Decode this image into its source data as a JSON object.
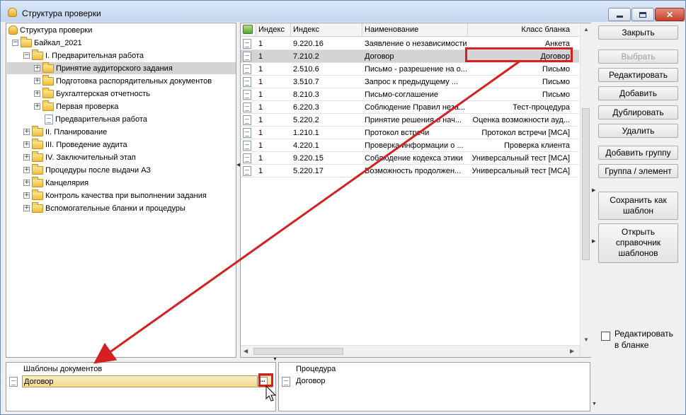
{
  "window": {
    "title": "Структура проверки",
    "icon": "database-icon",
    "controls": [
      "minimize-icon",
      "maximize-icon",
      "close-icon"
    ]
  },
  "tree": {
    "root": "Структура проверки",
    "project": "Байкал_2021",
    "section1": "I. Предварительная работа",
    "section1_items": [
      "Принятие аудиторского задания",
      "Подготовка распорядительных документов",
      "Бухгалтерская отчетность",
      "Первая проверка",
      "Предварительная работа"
    ],
    "sections": [
      "II. Планирование",
      "III. Проведение аудита",
      "IV. Заключительный этап",
      "Процедуры после выдачи АЗ",
      "Канцелярия",
      "Контроль качества при выполнении задания",
      "Вспомогательные бланки  и процедуры"
    ]
  },
  "grid": {
    "columns": [
      "Индекс",
      "Индекс",
      "Наименование",
      "Класс бланка"
    ],
    "rows": [
      {
        "i1": "1",
        "i2": "9.220.16",
        "name": "Заявление о независимости",
        "cls": "Анкета"
      },
      {
        "i1": "1",
        "i2": "7.210.2",
        "name": "Договор",
        "cls": "Договор"
      },
      {
        "i1": "1",
        "i2": "2.510.6",
        "name": "Письмо - разрешение на о...",
        "cls": "Письмо"
      },
      {
        "i1": "1",
        "i2": "3.510.7",
        "name": "Запрос к предыдущему ...",
        "cls": "Письмо"
      },
      {
        "i1": "1",
        "i2": "8.210.3",
        "name": "Письмо-соглашение",
        "cls": "Письмо"
      },
      {
        "i1": "1",
        "i2": "6.220.3",
        "name": "Соблюдение Правил неза...",
        "cls": "Тест-процедура"
      },
      {
        "i1": "1",
        "i2": "5.220.2",
        "name": "Принятие решения о нач...",
        "cls": "Оценка возможности ауд..."
      },
      {
        "i1": "1",
        "i2": "1.210.1",
        "name": "Протокол встречи",
        "cls": "Протокол встречи [МСА]"
      },
      {
        "i1": "1",
        "i2": "4.220.1",
        "name": "Проверка информации о ...",
        "cls": "Проверка клиента"
      },
      {
        "i1": "1",
        "i2": "9.220.15",
        "name": "Соблюдение кодекса этики",
        "cls": "Универсальный тест [МСА]"
      },
      {
        "i1": "1",
        "i2": "5.220.17",
        "name": "Возможность продолжен...",
        "cls": "Универсальный тест [МСА]"
      }
    ]
  },
  "buttons": {
    "close": "Закрыть",
    "select": "Выбрать",
    "edit": "Редактировать",
    "add": "Добавить",
    "duplicate": "Дублировать",
    "delete": "Удалить",
    "add_group": "Добавить группу",
    "group_element": "Группа / элемент",
    "save_template": "Сохранить как шаблон",
    "open_templates": "Открыть справочник шаблонов"
  },
  "edit_in_form": {
    "label": "Редактировать в бланке",
    "checked": false
  },
  "bottom": {
    "templates_header": "Шаблоны документов",
    "templates_value": "Договор",
    "procedure_header": "Процедура",
    "procedure_value": "Договор",
    "dots": "..."
  },
  "colors": {
    "selection": "#d4d4d4",
    "annotation": "#d42020",
    "field_fill": "#f4d98a"
  }
}
